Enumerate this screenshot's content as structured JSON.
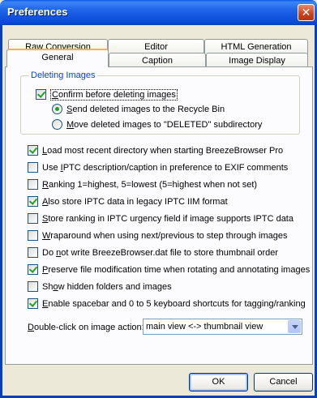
{
  "window": {
    "title": "Preferences",
    "close_glyph": "✕"
  },
  "tabs": {
    "row1": [
      "Raw Conversion",
      "Editor",
      "HTML Generation"
    ],
    "row2": [
      "General",
      "Caption",
      "Image Display"
    ],
    "active": "General"
  },
  "deleting": {
    "legend": "Deleting Images",
    "confirm_pre": "",
    "confirm_u": "C",
    "confirm_post": "onfirm before deleting images",
    "confirm_checked": true,
    "recycle_pre": "",
    "recycle_u": "S",
    "recycle_post": "end deleted images to the Recycle Bin",
    "recycle_selected": true,
    "move_pre": "",
    "move_u": "M",
    "move_post": "ove deleted images to \"DELETED\" subdirectory",
    "move_selected": false
  },
  "options": [
    {
      "pre": "",
      "u": "L",
      "post": "oad most recent directory when starting BreezeBrowser Pro",
      "checked": true
    },
    {
      "pre": "Use ",
      "u": "I",
      "post": "PTC description/caption in preference to EXIF comments",
      "checked": false
    },
    {
      "pre": "",
      "u": "R",
      "post": "anking 1=highest, 5=lowest (5=highest when not set)",
      "checked": false
    },
    {
      "pre": "",
      "u": "A",
      "post": "lso store IPTC data in legacy IPTC IIM format",
      "checked": true
    },
    {
      "pre": "",
      "u": "S",
      "post": "tore ranking in IPTC urgency field if image supports IPTC data",
      "checked": false
    },
    {
      "pre": "",
      "u": "W",
      "post": "raparound when using next/previous to step through images",
      "checked": false
    },
    {
      "pre": "Do ",
      "u": "n",
      "post": "ot write BreezeBrowser.dat file to store thumbnail order",
      "checked": false
    },
    {
      "pre": "",
      "u": "P",
      "post": "reserve file modification time when rotating and annotating images",
      "checked": true
    },
    {
      "pre": "Sh",
      "u": "o",
      "post": "w hidden folders and images",
      "checked": false
    },
    {
      "pre": "",
      "u": "E",
      "post": "nable spacebar and 0 to 5 keyboard shortcuts for tagging/ranking",
      "checked": true
    }
  ],
  "double_click": {
    "label_u": "D",
    "label_post": "ouble-click on image action:",
    "value": "main view <-> thumbnail view"
  },
  "buttons": {
    "ok": "OK",
    "cancel": "Cancel"
  }
}
